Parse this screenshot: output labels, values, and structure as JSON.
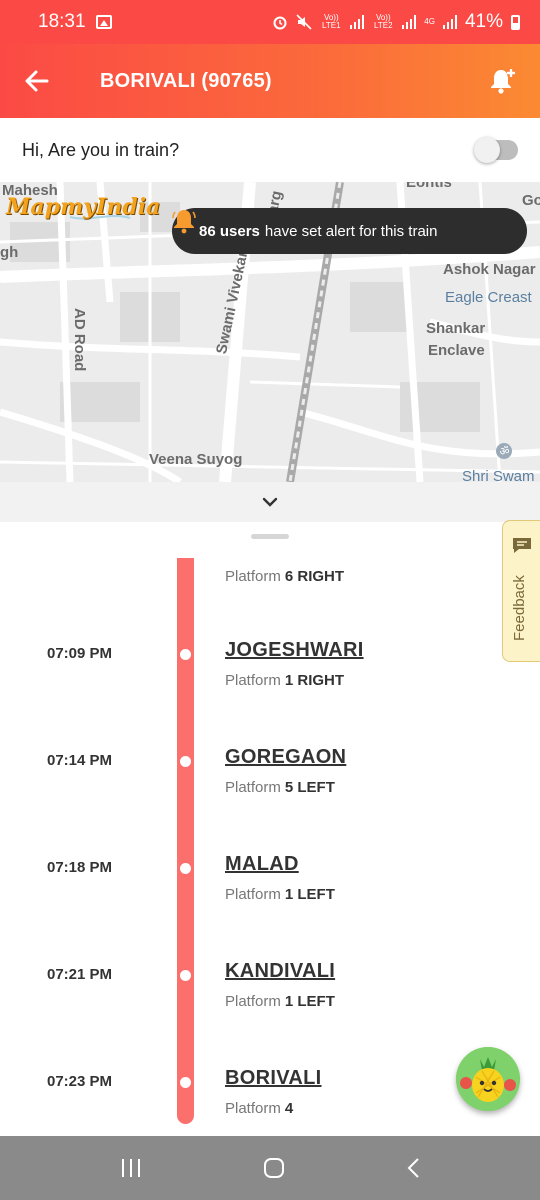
{
  "status_bar": {
    "time": "18:31",
    "sim1": "Vo)) LTE1",
    "sim2": "Vo)) LTE2",
    "net": "4G",
    "battery": "41%"
  },
  "app_bar": {
    "title": "BORIVALI (90765)"
  },
  "in_train": {
    "question": "Hi, Are you in train?",
    "toggle_on": false
  },
  "map": {
    "brand": "MapmyIndia",
    "labels": [
      "Mahesh",
      "gh",
      "AD Road",
      "Swami Vivekan",
      "arg",
      "Ashok Nagar",
      "Eagle Creast",
      "Shankar",
      "Enclave",
      "Veena Suyog",
      "Shri Swam",
      "Go",
      "Eohtis"
    ],
    "alert": {
      "count": "86 users",
      "text": "have set alert for this train"
    }
  },
  "timeline": {
    "platform_label": "Platform",
    "first_platform": "6 RIGHT",
    "stops": [
      {
        "time": "07:09 PM",
        "name": "JOGESHWARI",
        "platform": "1 RIGHT"
      },
      {
        "time": "07:14 PM",
        "name": "GOREGAON",
        "platform": "5 LEFT"
      },
      {
        "time": "07:18 PM",
        "name": "MALAD",
        "platform": "1 LEFT"
      },
      {
        "time": "07:21 PM",
        "name": "KANDIVALI",
        "platform": "1 LEFT"
      },
      {
        "time": "07:23 PM",
        "name": "BORIVALI",
        "platform": "4"
      }
    ]
  },
  "feedback": {
    "label": "Feedback"
  },
  "colors": {
    "accent": "#fb4a45",
    "rail": "#fb6f6c",
    "alert_bell": "#f89b2e"
  }
}
